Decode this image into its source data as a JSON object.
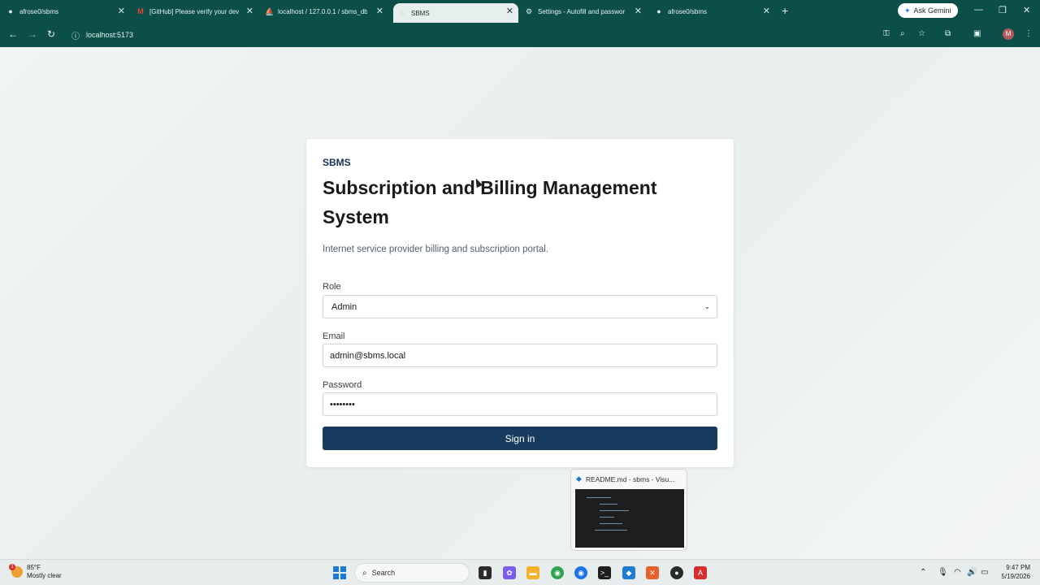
{
  "browser": {
    "tabs": [
      {
        "title": "afrose0/sbms",
        "icon": "github-icon",
        "active": false
      },
      {
        "title": "[GitHub] Please verify your dev",
        "icon": "gmail-icon",
        "active": false
      },
      {
        "title": "localhost / 127.0.0.1 / sbms_db",
        "icon": "phpmyadmin-icon",
        "active": false
      },
      {
        "title": "SBMS",
        "icon": "globe-icon",
        "active": true
      },
      {
        "title": "Settings - Autofill and passwor",
        "icon": "gear-icon",
        "active": false
      },
      {
        "title": "afrose0/sbms",
        "icon": "github-icon",
        "active": false
      }
    ],
    "ask_gemini": "Ask Gemini",
    "url": "localhost:5173",
    "profile_initial": "M"
  },
  "login": {
    "brand": "SBMS",
    "heading": "Subscription and Billing Management System",
    "subtitle": "Internet service provider billing and subscription portal.",
    "role_label": "Role",
    "role_value": "Admin",
    "email_label": "Email",
    "email_value": "admin@sbms.local",
    "password_label": "Password",
    "password_value": "••••••••",
    "signin_label": "Sign in"
  },
  "preview": {
    "title": "README.md - sbms - Visu..."
  },
  "taskbar": {
    "weather_temp": "85°F",
    "weather_desc": "Mostly clear",
    "weather_badge": "1",
    "search_label": "Search",
    "time": "9:47 PM",
    "date": "5/19/2026"
  },
  "colors": {
    "chrome": "#0b4f48",
    "brand": "#17325a",
    "button": "#173b5e"
  }
}
